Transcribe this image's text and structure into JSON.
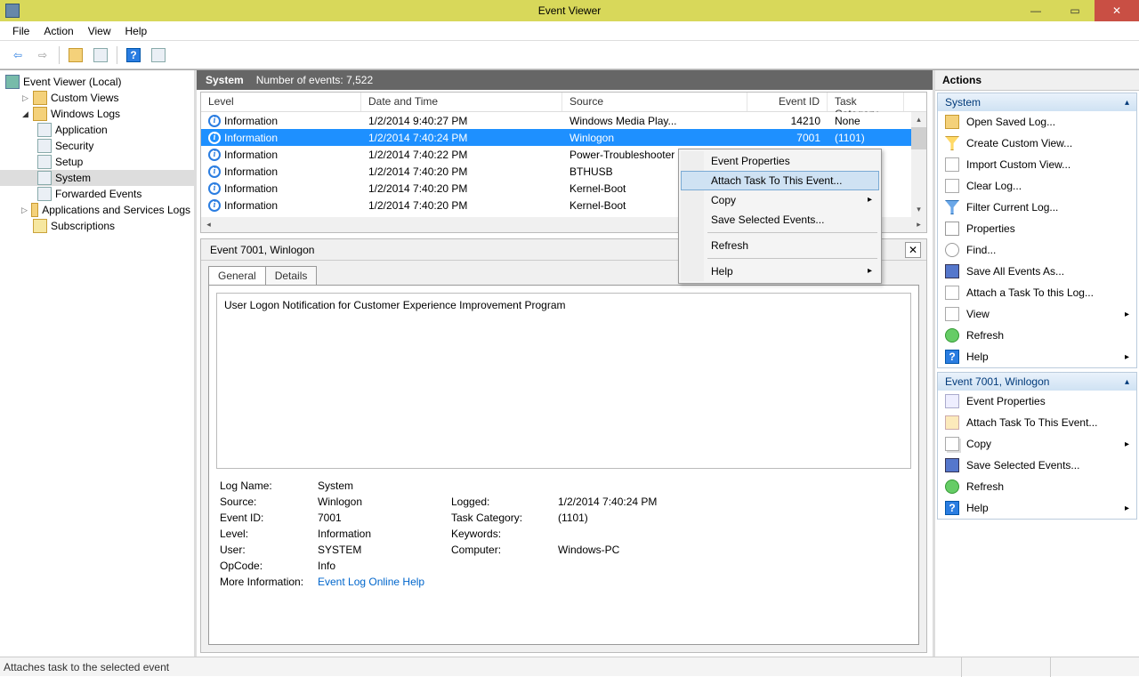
{
  "window": {
    "title": "Event Viewer"
  },
  "menubar": [
    "File",
    "Action",
    "View",
    "Help"
  ],
  "tree": {
    "root": "Event Viewer (Local)",
    "custom_views": "Custom Views",
    "windows_logs": "Windows Logs",
    "logs": [
      "Application",
      "Security",
      "Setup",
      "System",
      "Forwarded Events"
    ],
    "app_services": "Applications and Services Logs",
    "subscriptions": "Subscriptions"
  },
  "grid": {
    "title": "System",
    "count_label": "Number of events: 7,522",
    "columns": {
      "level": "Level",
      "date": "Date and Time",
      "source": "Source",
      "eid": "Event ID",
      "task": "Task Category"
    },
    "rows": [
      {
        "level": "Information",
        "date": "1/2/2014 9:40:27 PM",
        "source": "Windows Media Play...",
        "eid": "14210",
        "task": "None"
      },
      {
        "level": "Information",
        "date": "1/2/2014 7:40:24 PM",
        "source": "Winlogon",
        "eid": "7001",
        "task": "(1101)"
      },
      {
        "level": "Information",
        "date": "1/2/2014 7:40:22 PM",
        "source": "Power-Troubleshooter",
        "eid": "",
        "task": ""
      },
      {
        "level": "Information",
        "date": "1/2/2014 7:40:20 PM",
        "source": "BTHUSB",
        "eid": "",
        "task": ""
      },
      {
        "level": "Information",
        "date": "1/2/2014 7:40:20 PM",
        "source": "Kernel-Boot",
        "eid": "",
        "task": ""
      },
      {
        "level": "Information",
        "date": "1/2/2014 7:40:20 PM",
        "source": "Kernel-Boot",
        "eid": "",
        "task": ""
      }
    ]
  },
  "detail": {
    "title": "Event 7001, Winlogon",
    "tabs": {
      "general": "General",
      "details": "Details"
    },
    "description": "User Logon Notification for Customer Experience Improvement Program",
    "labels": {
      "logname": "Log Name:",
      "source": "Source:",
      "eventid": "Event ID:",
      "level": "Level:",
      "user": "User:",
      "opcode": "OpCode:",
      "moreinfo": "More Information:",
      "logged": "Logged:",
      "taskcat": "Task Category:",
      "keywords": "Keywords:",
      "computer": "Computer:"
    },
    "values": {
      "logname": "System",
      "source": "Winlogon",
      "eventid": "7001",
      "level": "Information",
      "user": "SYSTEM",
      "opcode": "Info",
      "logged": "1/2/2014 7:40:24 PM",
      "taskcat": "(1101)",
      "keywords": "",
      "computer": "Windows-PC",
      "moreinfo_link": "Event Log Online Help"
    }
  },
  "actions": {
    "header": "Actions",
    "section1_title": "System",
    "section1": [
      "Open Saved Log...",
      "Create Custom View...",
      "Import Custom View...",
      "Clear Log...",
      "Filter Current Log...",
      "Properties",
      "Find...",
      "Save All Events As...",
      "Attach a Task To this Log...",
      "View",
      "Refresh",
      "Help"
    ],
    "section2_title": "Event 7001, Winlogon",
    "section2": [
      "Event Properties",
      "Attach Task To This Event...",
      "Copy",
      "Save Selected Events...",
      "Refresh",
      "Help"
    ]
  },
  "context_menu": {
    "items": [
      {
        "label": "Event Properties",
        "arrow": false
      },
      {
        "label": "Attach Task To This Event...",
        "arrow": false,
        "hl": true
      },
      {
        "label": "Copy",
        "arrow": true
      },
      {
        "label": "Save Selected Events...",
        "arrow": false
      },
      {
        "sep": true
      },
      {
        "label": "Refresh",
        "arrow": false
      },
      {
        "sep": true
      },
      {
        "label": "Help",
        "arrow": true
      }
    ]
  },
  "statusbar": "Attaches task to the selected event"
}
